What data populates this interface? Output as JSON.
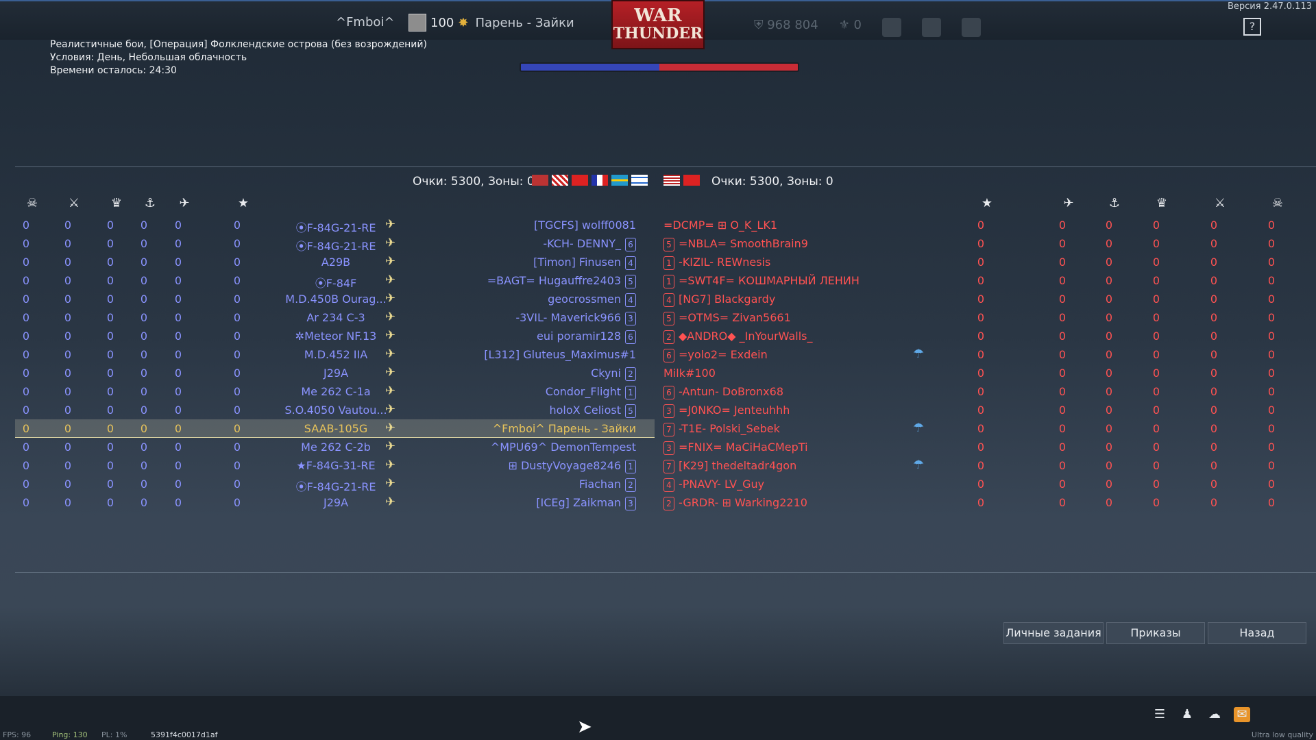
{
  "topbar": {
    "version": "Версия 2.47.0.113",
    "nickname": "^Fmboi^",
    "level": "100",
    "title": "Парень - Зайки",
    "logo_line1": "WAR",
    "logo_line2": "THUNDER",
    "silver": "968 804",
    "gold": "0",
    "help": "?"
  },
  "battle_info": {
    "mode": "Реалистичные бои, [Операция] Фолклендские острова (без возрождений)",
    "conditions": "Условия: День, Небольшая облачность",
    "time_left": "Времени осталось: 24:30"
  },
  "team_scores": {
    "left": "Очки: 5300, Зоны: 0",
    "right": "Очки: 5300, Зоны: 0"
  },
  "rows": [
    {
      "vehicle": "⦿F-84G-21-RE",
      "plane": "✈",
      "lplayer": "[TGCFS] wolff0081",
      "lrank": "",
      "rrank": "",
      "rplayer": "=DCMP= ⊞ O_K_LK1",
      "para": false
    },
    {
      "vehicle": "⦿F-84G-21-RE",
      "plane": "✈",
      "lplayer": "-KCH- DENNY_",
      "lrank": "6",
      "rrank": "5",
      "rplayer": "=NBLA= SmoothBrain9",
      "para": false
    },
    {
      "vehicle": "A29B",
      "plane": "✈",
      "lplayer": "[Timon] Finusen",
      "lrank": "4",
      "rrank": "1",
      "rplayer": "-KIZIL- REWnesis",
      "para": false
    },
    {
      "vehicle": "⦿F-84F",
      "plane": "✈",
      "lplayer": "=BAGT= Hugauffre2403",
      "lrank": "5",
      "rrank": "1",
      "rplayer": "=SWT4F= КОШМАРНЫЙ ЛЕНИН",
      "para": false
    },
    {
      "vehicle": "M.D.450B Ourag...",
      "plane": "✈",
      "lplayer": "geocrossmen",
      "lrank": "4",
      "rrank": "4",
      "rplayer": "[NG7] Blackgardy",
      "para": false
    },
    {
      "vehicle": "Ar 234 C-3",
      "plane": "✈",
      "lplayer": "-3VIL- Maverick966",
      "lrank": "3",
      "rrank": "5",
      "rplayer": "=OTMS= Zivan5661",
      "para": false
    },
    {
      "vehicle": "✲Meteor NF.13",
      "plane": "✈",
      "lplayer": "euі poramir128",
      "lrank": "6",
      "rrank": "2",
      "rplayer": "◆ANDRO◆ _InYourWalls_",
      "para": false
    },
    {
      "vehicle": "M.D.452 IIA",
      "plane": "✈",
      "lplayer": "[L312] Gluteus_Maximus#1",
      "lrank": "",
      "rrank": "6",
      "rplayer": "=yolo2= Exdein",
      "para": true
    },
    {
      "vehicle": "J29A",
      "plane": "✈",
      "lplayer": "Ckyni",
      "lrank": "2",
      "rrank": "",
      "rplayer": "Milk#100",
      "para": false
    },
    {
      "vehicle": "Me 262 C-1a",
      "plane": "✈",
      "lplayer": "Condor_Flight",
      "lrank": "1",
      "rrank": "6",
      "rplayer": "-Antun- DoBronx68",
      "para": false
    },
    {
      "vehicle": "S.O.4050 Vautou...",
      "plane": "✈",
      "lplayer": "holoX Celiost",
      "lrank": "5",
      "rrank": "3",
      "rplayer": "=J0NKO= Jenteuhhh",
      "para": false
    },
    {
      "vehicle": "SAAB-105G",
      "plane": "✈",
      "lplayer": "^Fmboi^ Парень - Зайки",
      "lrank": "",
      "rrank": "7",
      "rplayer": "-T1E- Polski_Sebek",
      "para": true,
      "highlight": true
    },
    {
      "vehicle": "Me 262 C-2b",
      "plane": "✈",
      "lplayer": "^MPU69^ DemonTempest",
      "lrank": "",
      "rrank": "3",
      "rplayer": "=FNIX= MaCiHaCMepTi",
      "para": false
    },
    {
      "vehicle": "★F-84G-31-RE",
      "plane": "✈",
      "lplayer": "⊞ DustyVoyage8246",
      "lrank": "1",
      "rrank": "7",
      "rplayer": "[K29] thedeltadr4gon",
      "para": true
    },
    {
      "vehicle": "⦿F-84G-21-RE",
      "plane": "✈",
      "lplayer": "Fiachan",
      "lrank": "2",
      "rrank": "4",
      "rplayer": "-PNAVY- LV_Guy",
      "para": false
    },
    {
      "vehicle": "J29A",
      "plane": "✈",
      "lplayer": "[ICEg] Zaikman",
      "lrank": "3",
      "rrank": "2",
      "rplayer": "-GRDR- ⊞ Warking2210",
      "para": false
    }
  ],
  "zero": "0",
  "icons": {
    "col1": "☠",
    "col2": "⚔",
    "col3": "♛",
    "col4": "⚓",
    "col5": "✈",
    "col6": "★",
    "parachute": "☂"
  },
  "buttons": {
    "tasks": "Личные задания",
    "orders": "Приказы",
    "back": "Назад"
  },
  "statusbar": {
    "fps": "FPS: 96",
    "ping": "Ping: 130",
    "pl": "PL: 1%",
    "session": "5391f4c0017d1af",
    "quality": "Ultra low quality"
  },
  "colors": {
    "ally": "#8a93ff",
    "enemy": "#ff5252",
    "self": "#e7c35b"
  }
}
